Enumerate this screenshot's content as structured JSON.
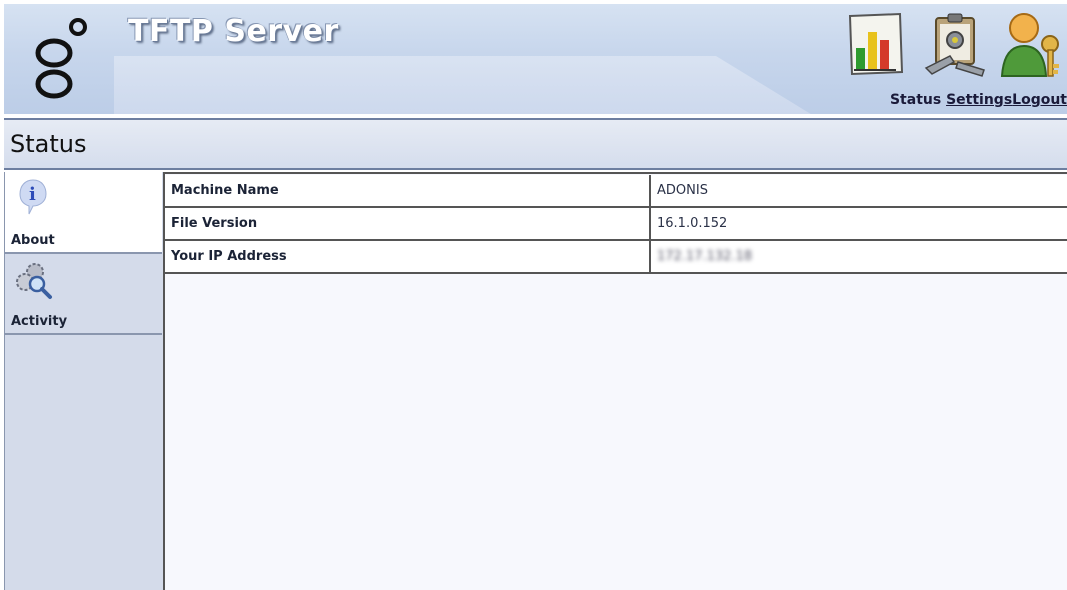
{
  "header": {
    "title": "TFTP Server",
    "nav": [
      {
        "label": "Status",
        "icon": "chart-icon"
      },
      {
        "label": "Settings",
        "icon": "settings-clipboard-icon"
      },
      {
        "label": "Logout",
        "icon": "user-key-icon"
      }
    ]
  },
  "page": {
    "title": "Status"
  },
  "sidebar": {
    "items": [
      {
        "label": "About",
        "icon": "info-icon",
        "active": true
      },
      {
        "label": "Activity",
        "icon": "gears-magnifier-icon",
        "active": false
      }
    ]
  },
  "status_table": {
    "rows": [
      {
        "key": "Machine Name",
        "value": "ADONIS"
      },
      {
        "key": "File Version",
        "value": "16.1.0.152"
      },
      {
        "key": "Your IP Address",
        "value": "172.17.132.18"
      }
    ]
  }
}
